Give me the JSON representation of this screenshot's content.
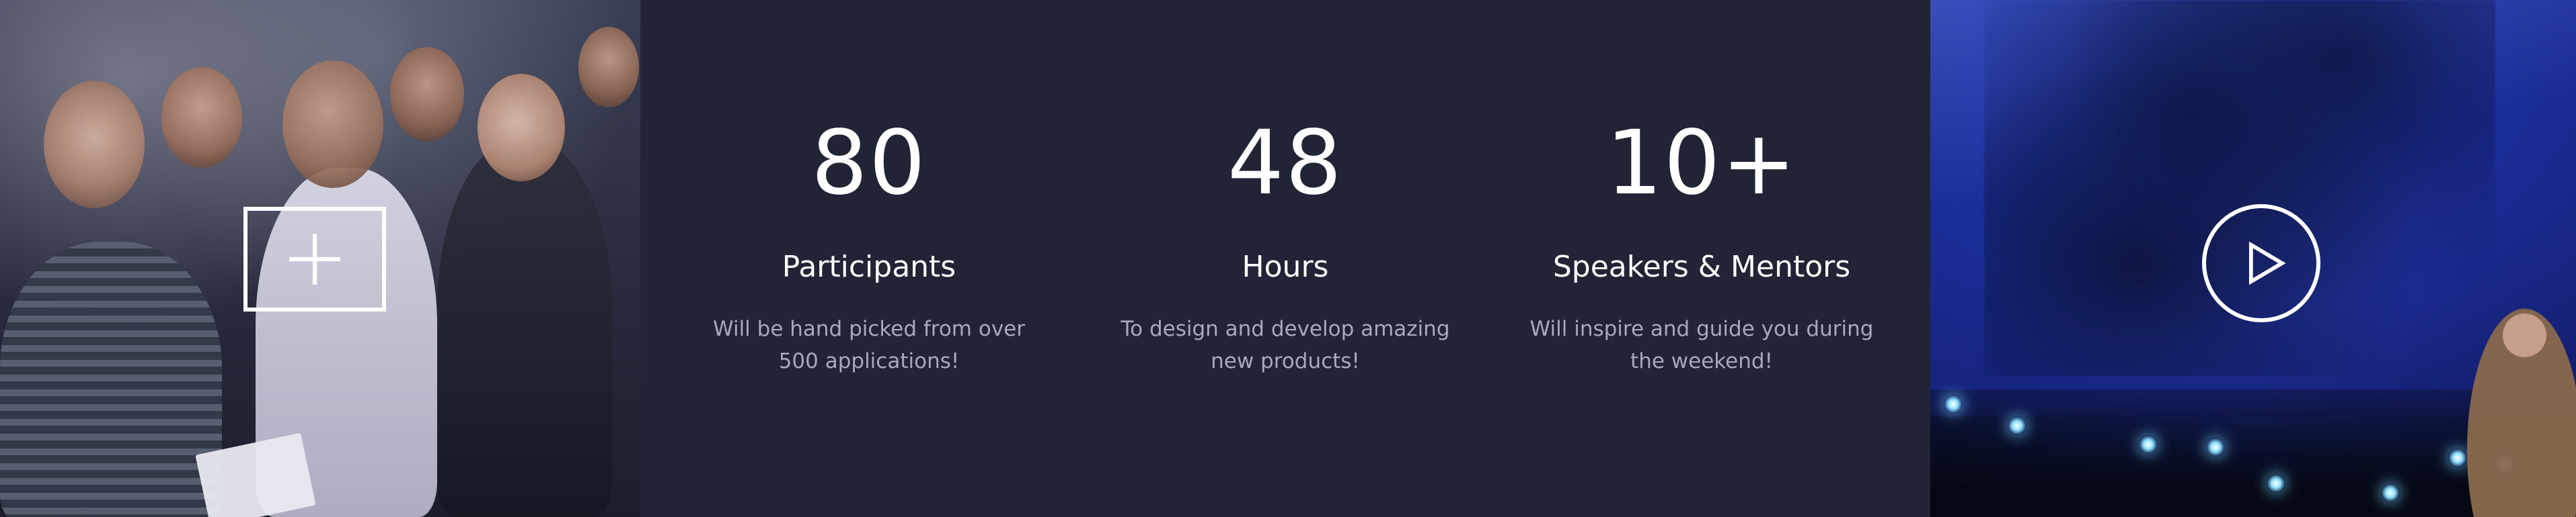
{
  "left_panel": {
    "icon": "plus-icon"
  },
  "stats": [
    {
      "number": "80",
      "title": "Participants",
      "desc": "Will be hand picked from over 500 applications!"
    },
    {
      "number": "48",
      "title": "Hours",
      "desc": "To design and develop amazing new products!"
    },
    {
      "number": "10+",
      "title": "Speakers & Mentors",
      "desc": "Will inspire and guide you during the weekend!"
    }
  ],
  "right_panel": {
    "icon": "play-icon"
  },
  "colors": {
    "background": "#212435",
    "text_primary": "#ffffff",
    "text_secondary": "#a7aab8"
  }
}
